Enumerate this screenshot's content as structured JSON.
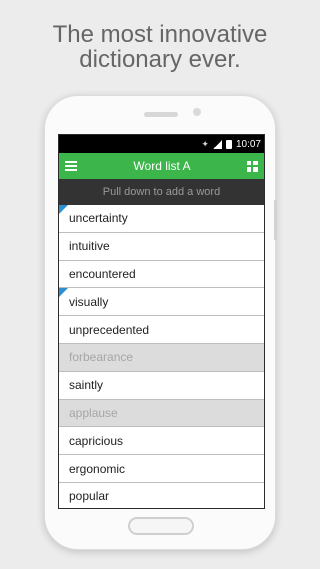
{
  "tagline": {
    "line1": "The most innovative",
    "line2": "dictionary ever."
  },
  "status_bar": {
    "time": "10:07"
  },
  "app_bar": {
    "title": "Word list A"
  },
  "pull_hint": "Pull down to add a word",
  "words": [
    {
      "text": "uncertainty",
      "flagged": true,
      "dimmed": false
    },
    {
      "text": "intuitive",
      "flagged": false,
      "dimmed": false
    },
    {
      "text": "encountered",
      "flagged": false,
      "dimmed": false
    },
    {
      "text": "visually",
      "flagged": true,
      "dimmed": false
    },
    {
      "text": "unprecedented",
      "flagged": false,
      "dimmed": false
    },
    {
      "text": "forbearance",
      "flagged": false,
      "dimmed": true
    },
    {
      "text": "saintly",
      "flagged": false,
      "dimmed": false
    },
    {
      "text": "applause",
      "flagged": false,
      "dimmed": true
    },
    {
      "text": "capricious",
      "flagged": false,
      "dimmed": false
    },
    {
      "text": "ergonomic",
      "flagged": false,
      "dimmed": false
    },
    {
      "text": "popular",
      "flagged": false,
      "dimmed": false
    }
  ],
  "colors": {
    "accent": "#3cb64a",
    "flag": "#2b8fd1",
    "dimmed_row": "#dcdcdc"
  }
}
